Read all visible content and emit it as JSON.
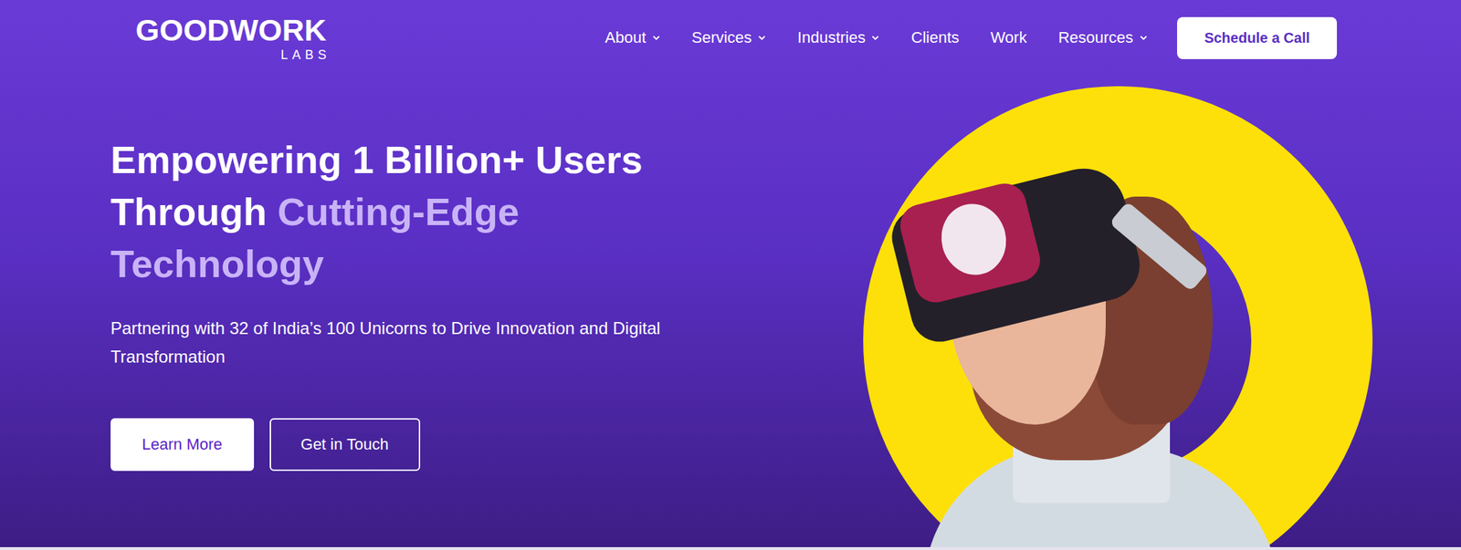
{
  "logo": {
    "name": "GOODWORK",
    "sub": "LABS"
  },
  "nav": {
    "items": [
      {
        "label": "About",
        "has_menu": true
      },
      {
        "label": "Services",
        "has_menu": true
      },
      {
        "label": "Industries",
        "has_menu": true
      },
      {
        "label": "Clients",
        "has_menu": false
      },
      {
        "label": "Work",
        "has_menu": false
      },
      {
        "label": "Resources",
        "has_menu": true
      }
    ],
    "cta": "Schedule a Call"
  },
  "hero": {
    "headline": "Empowering 1 Billion+ Users Through",
    "highlight": "Cutting-Edge Technology",
    "subtitle": "Partnering with 32 of India’s 100 Unicorns to Drive Innovation and Digital Transformation",
    "buttons": [
      "Learn More",
      "Get in Touch"
    ]
  }
}
